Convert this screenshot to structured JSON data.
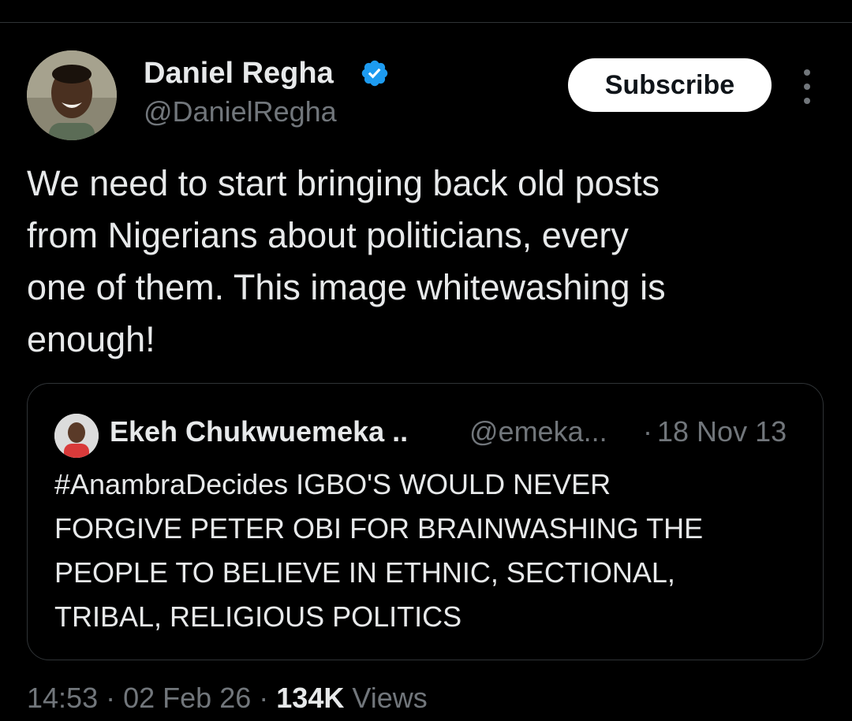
{
  "author": {
    "display_name": "Daniel Regha",
    "handle": "@DanielRegha",
    "verified": true
  },
  "actions": {
    "subscribe_label": "Subscribe",
    "more_icon": "more-vertical-icon"
  },
  "tweet": {
    "text": "We need to start bringing back old posts\nfrom Nigerians about politicians, every\none of them. This image whitewashing is\nenough!"
  },
  "quoted_tweet": {
    "display_name": "Ekeh Chukwuemeka ..",
    "handle": "@emeka...",
    "separator": "·",
    "date": "18 Nov 13",
    "text": "#AnambraDecides IGBO'S WOULD NEVER\nFORGIVE PETER OBI FOR BRAINWASHING THE\nPEOPLE TO BELIEVE IN ETHNIC, SECTIONAL,\nTRIBAL, RELIGIOUS POLITICS"
  },
  "meta": {
    "time": "14:53",
    "separator": "·",
    "date": "02 Feb 26",
    "views_count": "134K",
    "views_label": "Views"
  },
  "colors": {
    "background": "#000000",
    "primary_text": "#e7e9ea",
    "secondary_text": "#71767b",
    "border": "#2f3336",
    "verified_blue": "#1d9bf0",
    "button_bg": "#ffffff"
  }
}
